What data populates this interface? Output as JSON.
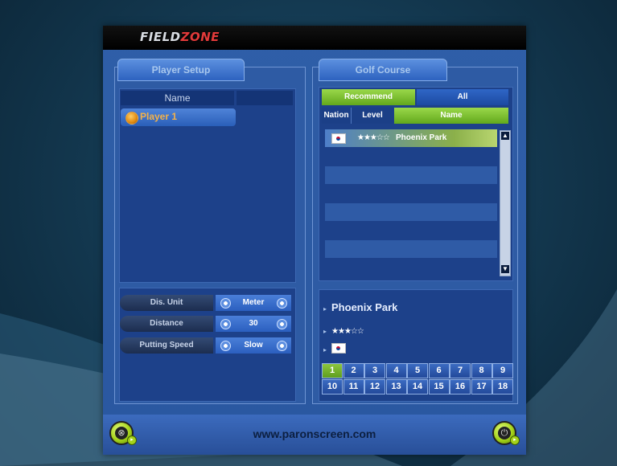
{
  "app": {
    "logo_main": "FIELD",
    "logo_accent": "ZONE",
    "url": "www.paronscreen.com"
  },
  "player_setup": {
    "title": "Player Setup",
    "columns": [
      "Name",
      ""
    ],
    "players": [
      {
        "name": "Player 1"
      }
    ],
    "settings": [
      {
        "label": "Dis. Unit",
        "value": "Meter"
      },
      {
        "label": "Distance",
        "value": "30"
      },
      {
        "label": "Putting Speed",
        "value": "Slow"
      }
    ]
  },
  "golf_course": {
    "title": "Golf Course",
    "tabs": [
      {
        "label": "Recommend",
        "active": true
      },
      {
        "label": "All",
        "active": false
      }
    ],
    "columns": {
      "nation": "Nation",
      "level": "Level",
      "name": "Name"
    },
    "courses": [
      {
        "nation": "Korea",
        "stars_filled": 3,
        "stars_total": 5,
        "name": "Phoenix Park"
      }
    ],
    "detail": {
      "name": "Phoenix Park",
      "stars_filled": 3,
      "stars_total": 5,
      "nation": "Korea"
    },
    "holes": [
      "1",
      "2",
      "3",
      "4",
      "5",
      "6",
      "7",
      "8",
      "9",
      "10",
      "11",
      "12",
      "13",
      "14",
      "15",
      "16",
      "17",
      "18"
    ],
    "selected_hole": "1"
  },
  "colors": {
    "accent_green": "#8dc63f",
    "panel_blue": "#2e5ba4",
    "player_orange": "#f4b24a"
  },
  "icons": {
    "left_button": "exit-icon",
    "right_button": "plug-icon"
  }
}
